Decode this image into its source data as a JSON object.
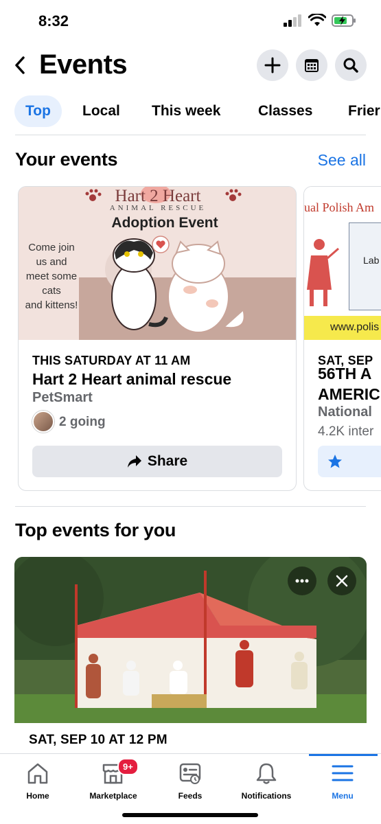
{
  "status": {
    "time": "8:32"
  },
  "header": {
    "title": "Events"
  },
  "tabs": [
    "Top",
    "Local",
    "This week",
    "Classes",
    "Frier"
  ],
  "your_events": {
    "title": "Your events",
    "see_all": "See all",
    "cards": [
      {
        "poster": {
          "brand": "Hart 2 Heart",
          "sub": "ANIMAL RESCUE",
          "headline": "Adoption Event",
          "blurb": [
            "Come join",
            "us and",
            "meet some",
            "cats",
            "and kittens!"
          ]
        },
        "date": "THIS SATURDAY AT 11 AM",
        "name": "Hart 2 Heart animal rescue",
        "venue": "PetSmart",
        "going": "2 going",
        "action": "Share"
      },
      {
        "poster": {
          "banner": "ual Polish Am",
          "label": "Lab",
          "url": "www.polis"
        },
        "date": "SAT, SEP",
        "name_line1": "56TH A",
        "name_line2": "AMERIC",
        "venue": "National",
        "going": "4.2K inter"
      }
    ]
  },
  "top_events": {
    "title": "Top events for you",
    "date": "SAT, SEP 10 AT 12 PM"
  },
  "nav": [
    {
      "label": "Home",
      "icon": "home-icon"
    },
    {
      "label": "Marketplace",
      "icon": "marketplace-icon",
      "badge": "9+"
    },
    {
      "label": "Feeds",
      "icon": "feeds-icon"
    },
    {
      "label": "Notifications",
      "icon": "bell-icon"
    },
    {
      "label": "Menu",
      "icon": "menu-icon",
      "active": true
    }
  ],
  "colors": {
    "accent": "#1b74e4",
    "tab_bg": "#e7f0fd",
    "button_bg": "#e4e6eb",
    "badge": "#e41e3f"
  }
}
